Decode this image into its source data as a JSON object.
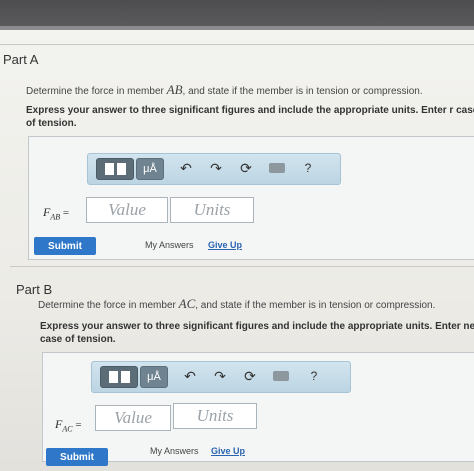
{
  "partA": {
    "title": "Part A",
    "prompt_pre": "Determine the force in member ",
    "member": "AB",
    "prompt_post": ", and state if the member is in tension or compression.",
    "instruction": "Express your answer to three significant figures and include the appropriate units. Enter r case of tension.",
    "label_main": "F",
    "label_sub": "AB",
    "label_eq": " =",
    "value_placeholder": "Value",
    "units_placeholder": "Units",
    "submit": "Submit",
    "my_answers": "My Answers",
    "give_up": "Give Up"
  },
  "partB": {
    "title": "Part B",
    "prompt_pre": "Determine the force in member ",
    "member": "AC",
    "prompt_post": ", and state if the member is in tension or compression.",
    "instruction": "Express your answer to three significant figures and include the appropriate units. Enter neg case of tension.",
    "label_main": "F",
    "label_sub": "AC",
    "label_eq": " =",
    "value_placeholder": "Value",
    "units_placeholder": "Units",
    "submit": "Submit",
    "my_answers": "My Answers",
    "give_up": "Give Up"
  },
  "toolbar": {
    "mu_label": "μÅ",
    "undo_icon": "↶",
    "redo_icon": "↷",
    "reset_icon": "⟳",
    "help_label": "?"
  }
}
